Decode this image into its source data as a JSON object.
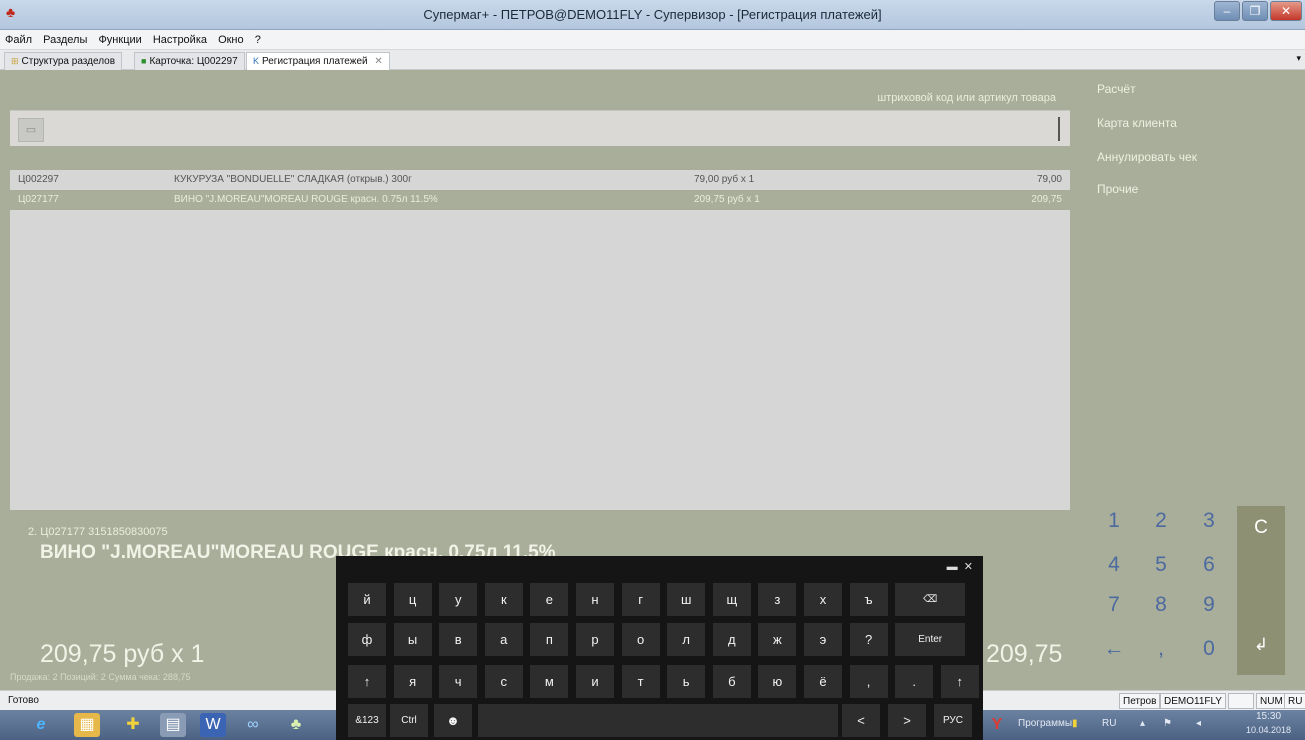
{
  "window": {
    "title": "Супермаг+ - ПЕТРОВ@DEMO11FLY - Супервизор - [Регистрация платежей]",
    "controls": [
      "–",
      "❐",
      "✕"
    ]
  },
  "menu": [
    "Файл",
    "Разделы",
    "Функции",
    "Настройка",
    "Окно",
    "?"
  ],
  "tabs": [
    {
      "label": "Структура разделов",
      "icon": "tree-icon"
    },
    {
      "label": "Карточка: Ц002297",
      "icon": "card-icon"
    },
    {
      "label": "Регистрация платежей",
      "icon": "register-icon",
      "active": true
    }
  ],
  "register": {
    "hint": "штриховой код или артикул товара",
    "items": [
      {
        "code": "Ц002297",
        "name": "КУКУРУЗА \"BONDUELLE\" СЛАДКАЯ (открыв.) 300г",
        "price": "79,00 руб  x 1",
        "total": "79,00"
      },
      {
        "code": "Ц027177",
        "name": "ВИНО \"J.MOREAU\"MOREAU ROUGE красн. 0.75л 11.5%",
        "price": "209,75 руб  x 1",
        "total": "209,75"
      }
    ],
    "selected": {
      "code_line": "2.  Ц027177  3151850830075",
      "name": "ВИНО \"J.MOREAU\"MOREAU ROUGE красн. 0.75л 11.5%",
      "price_line": "209,75 руб x 1",
      "total": "209,75"
    },
    "summary": "Продажа: 2   Позиций: 2   Сумма чека: 288,75"
  },
  "actions": [
    "Расчёт",
    "Карта клиента",
    "Аннулировать чек",
    "Прочие"
  ],
  "numpad": {
    "keys": [
      "1",
      "2",
      "3",
      "4",
      "5",
      "6",
      "7",
      "8",
      "9",
      "←",
      ",",
      "0"
    ],
    "clear": "C",
    "enter": "↲"
  },
  "keyboard": {
    "row1": [
      "й",
      "ц",
      "у",
      "к",
      "е",
      "н",
      "г",
      "ш",
      "щ",
      "з",
      "х",
      "ъ",
      "⌫"
    ],
    "row2": [
      "ф",
      "ы",
      "в",
      "а",
      "п",
      "р",
      "о",
      "л",
      "д",
      "ж",
      "э",
      "?",
      "Enter"
    ],
    "row3": [
      "↑",
      "я",
      "ч",
      "с",
      "м",
      "и",
      "т",
      "ь",
      "б",
      "ю",
      "ё",
      ",",
      ".",
      "↑"
    ],
    "row4": [
      "&123",
      "Ctrl",
      "☻",
      "",
      "<",
      ">",
      "РУС"
    ]
  },
  "status": {
    "ready": "Готово",
    "user": "Петров",
    "db": "DEMO11FLY",
    "num": "NUM",
    "lang": "RU"
  },
  "taskbar": {
    "programs": "Программы",
    "lang": "RU",
    "time": "15:30",
    "date": "10.04.2018"
  }
}
